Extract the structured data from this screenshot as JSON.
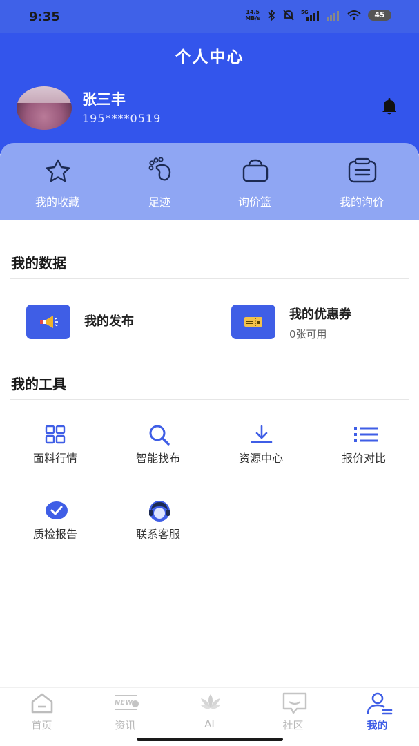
{
  "status_bar": {
    "time": "9:35",
    "net_speed_value": "14.5",
    "net_speed_unit": "MB/s",
    "battery": "45",
    "network": "5G"
  },
  "header": {
    "title": "个人中心"
  },
  "user": {
    "name": "张三丰",
    "phone": "195****0519"
  },
  "quick_actions": [
    {
      "label": "我的收藏",
      "icon": "star-icon"
    },
    {
      "label": "足迹",
      "icon": "footprint-icon"
    },
    {
      "label": "询价篮",
      "icon": "basket-icon"
    },
    {
      "label": "我的询价",
      "icon": "clipboard-icon"
    }
  ],
  "my_data": {
    "title": "我的数据",
    "items": [
      {
        "label": "我的发布",
        "sub": "",
        "icon": "megaphone-icon"
      },
      {
        "label": "我的优惠券",
        "sub": "0张可用",
        "icon": "coupon-icon"
      }
    ]
  },
  "my_tools": {
    "title": "我的工具",
    "items": [
      {
        "label": "面料行情",
        "icon": "grid-icon"
      },
      {
        "label": "智能找布",
        "icon": "search-icon"
      },
      {
        "label": "资源中心",
        "icon": "download-icon"
      },
      {
        "label": "报价对比",
        "icon": "list-icon"
      },
      {
        "label": "质检报告",
        "icon": "check-circle-icon"
      },
      {
        "label": "联系客服",
        "icon": "customer-service-icon"
      }
    ]
  },
  "tab_bar": {
    "active": "我的",
    "items": [
      {
        "label": "首页",
        "icon": "home-icon",
        "badge": ""
      },
      {
        "label": "资讯",
        "icon": "news-icon",
        "badge": "NEW"
      },
      {
        "label": "AI",
        "icon": "ai-lotus-icon",
        "badge": ""
      },
      {
        "label": "社区",
        "icon": "chat-bubble-icon",
        "badge": ""
      },
      {
        "label": "我的",
        "icon": "profile-icon",
        "badge": ""
      }
    ]
  },
  "colors": {
    "brand": "#3355ec",
    "panel": "#8fa6f3",
    "accent": "#3f5ee6",
    "tab_inactive": "#b9b9b9"
  }
}
